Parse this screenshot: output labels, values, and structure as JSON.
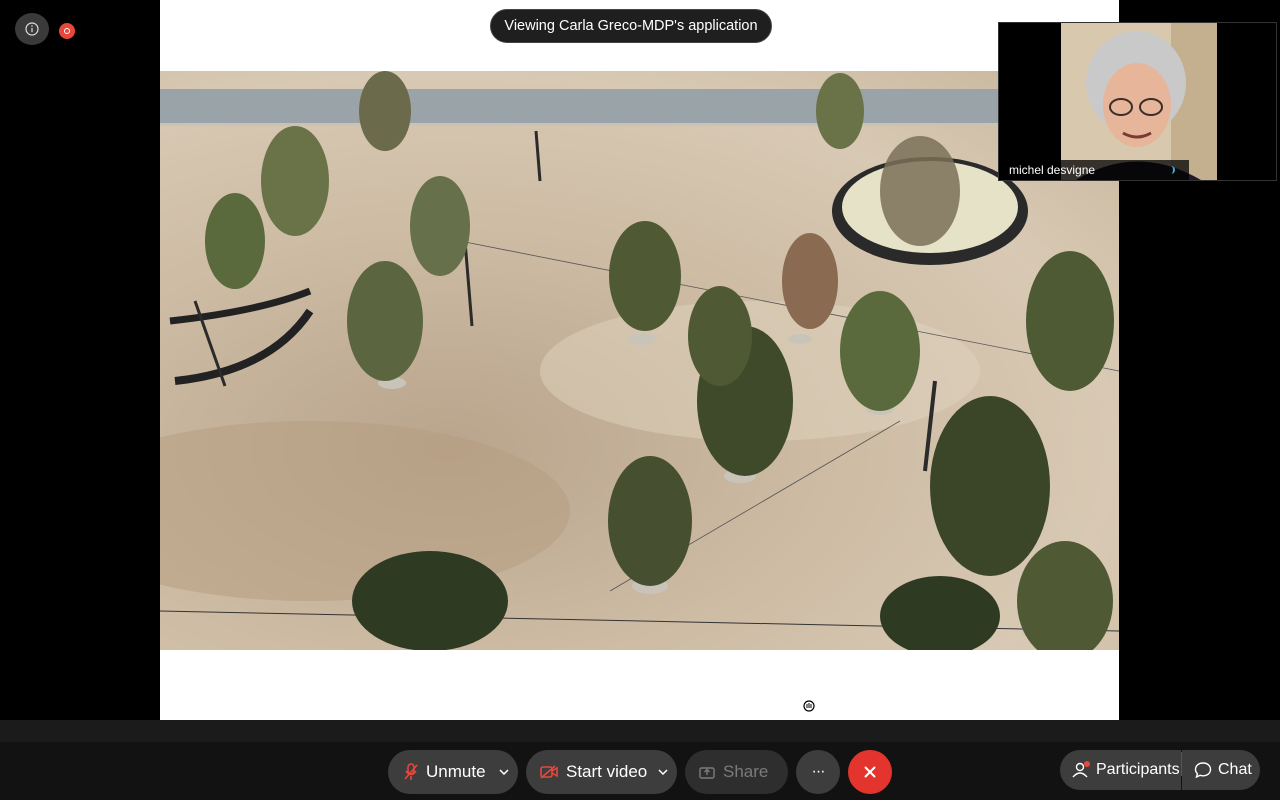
{
  "top_controls": {
    "info_icon": "info-icon",
    "record_icon": "recording-indicator-icon",
    "record_color": "#e8483b"
  },
  "share": {
    "banner": "Viewing Carla Greco-MDP's application",
    "image_alt": "Aerial view of a plaza with trees, benches and a circular pool"
  },
  "participant": {
    "name": "michel desvigne"
  },
  "toolbar": {
    "unmute_label": "Unmute",
    "start_video_label": "Start video",
    "share_label": "Share",
    "more_label": "···",
    "participants_label": "Participants",
    "chat_label": "Chat",
    "end_color": "#e3352d",
    "badge_color": "#e8483b"
  }
}
